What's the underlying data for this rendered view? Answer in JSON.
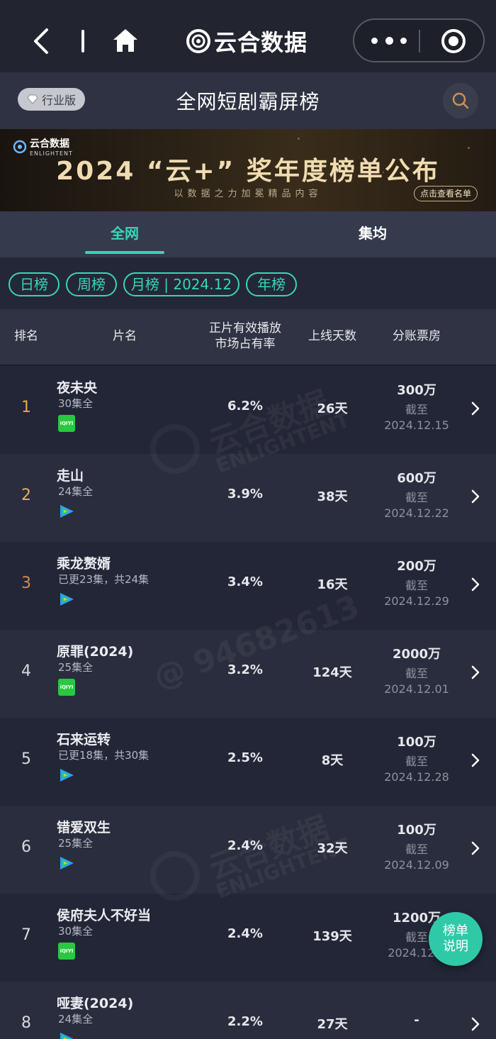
{
  "topbar": {
    "brand": "云合数据"
  },
  "header": {
    "badge": "行业版",
    "title": "全网短剧霸屏榜"
  },
  "banner": {
    "logo_cn": "云合数据",
    "logo_en": "ENLIGHTENT",
    "headline": "2024 “云+” 奖年度榜单公布",
    "subtitle": "以数据之力加冕精品内容",
    "cta": "点击查看名单"
  },
  "tabs": [
    {
      "label": "全网",
      "active": true
    },
    {
      "label": "集均",
      "active": false
    }
  ],
  "filters": [
    {
      "label": "日榜"
    },
    {
      "label": "周榜"
    },
    {
      "label": "月榜 | 2024.12"
    },
    {
      "label": "年榜"
    }
  ],
  "table": {
    "headers": {
      "rank": "排名",
      "name": "片名",
      "share_line1": "正片有效播放",
      "share_line2": "市场占有率",
      "days": "上线天数",
      "box": "分账票房"
    },
    "rows": [
      {
        "rank": "1",
        "title": "夜未央",
        "eps": "30集全",
        "platform": "iqiyi",
        "share": "6.2%",
        "days": "26天",
        "box": "300万",
        "asof_label": "截至",
        "asof_date": "2024.12.15"
      },
      {
        "rank": "2",
        "title": "走山",
        "eps": "24集全",
        "platform": "tencent",
        "share": "3.9%",
        "days": "38天",
        "box": "600万",
        "asof_label": "截至",
        "asof_date": "2024.12.22"
      },
      {
        "rank": "3",
        "title": "乘龙赘婿",
        "eps": "已更23集，共24集",
        "platform": "tencent",
        "share": "3.4%",
        "days": "16天",
        "box": "200万",
        "asof_label": "截至",
        "asof_date": "2024.12.29"
      },
      {
        "rank": "4",
        "title": "原罪(2024)",
        "eps": "25集全",
        "platform": "iqiyi",
        "share": "3.2%",
        "days": "124天",
        "box": "2000万",
        "asof_label": "截至",
        "asof_date": "2024.12.01"
      },
      {
        "rank": "5",
        "title": "石来运转",
        "eps": "已更18集，共30集",
        "platform": "tencent",
        "share": "2.5%",
        "days": "8天",
        "box": "100万",
        "asof_label": "截至",
        "asof_date": "2024.12.28"
      },
      {
        "rank": "6",
        "title": "错爱双生",
        "eps": "25集全",
        "platform": "tencent",
        "share": "2.4%",
        "days": "32天",
        "box": "100万",
        "asof_label": "截至",
        "asof_date": "2024.12.09"
      },
      {
        "rank": "7",
        "title": "侯府夫人不好当",
        "eps": "30集全",
        "platform": "iqiyi",
        "share": "2.4%",
        "days": "139天",
        "box": "1200万",
        "asof_label": "截至",
        "asof_date": "2024.12.1"
      },
      {
        "rank": "8",
        "title": "哑妻(2024)",
        "eps": "24集全",
        "platform": "tencent",
        "share": "2.2%",
        "days": "27天",
        "box": "-",
        "asof_label": "",
        "asof_date": ""
      }
    ]
  },
  "iqiyi_logo_text": "iQIYI",
  "watermarks": {
    "brand_cn": "云合数据",
    "brand_en": "ENLIGHTENT",
    "user_id": "@ 94682613"
  },
  "fab": {
    "line1": "榜单",
    "line2": "说明"
  },
  "colors": {
    "accent": "#38d5b8",
    "background": "#242737",
    "topbar": "#22252f",
    "rank_top": "#e6a84a"
  }
}
